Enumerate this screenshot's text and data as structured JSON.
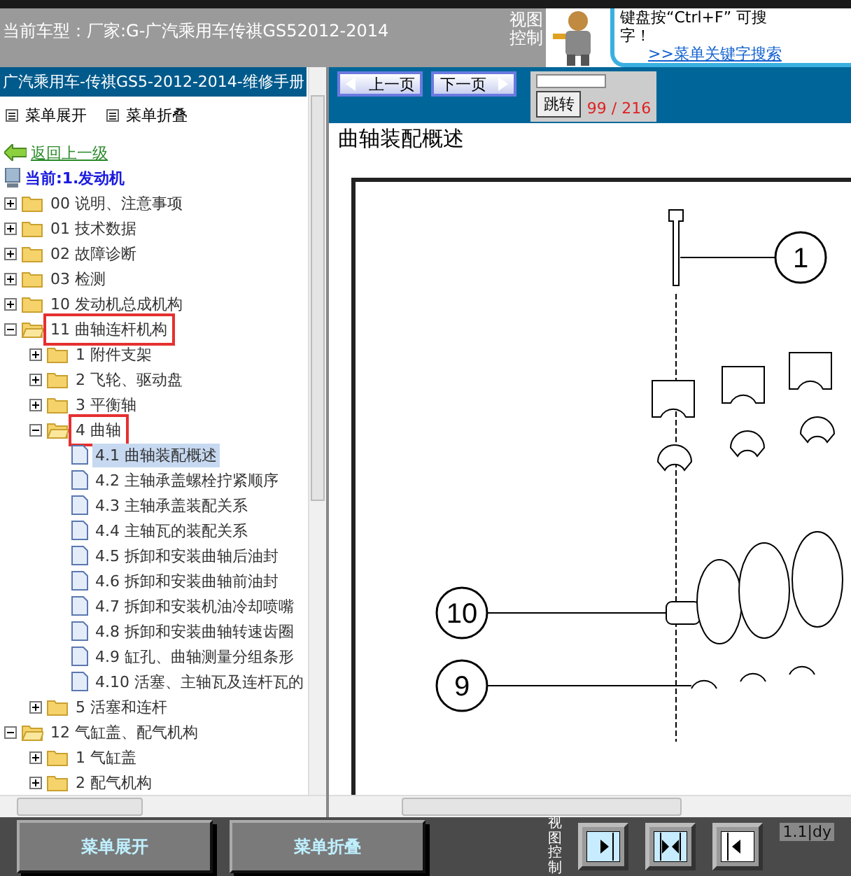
{
  "header": {
    "vehicle": "当前车型：厂家:G-广汽乘用车传祺GS52012-2014",
    "view_control": "视图控制",
    "tip_lines": [
      "键盘按“Ctrl+F” 可搜",
      "字！"
    ],
    "tip_link": ">>菜单关键字搜索"
  },
  "sidebar": {
    "title": "广汽乘用车-传祺GS5-2012-2014-维修手册",
    "menu": [
      "菜单展开",
      "菜单折叠"
    ],
    "back_link": "返回上一级",
    "current": "当前:1.发动机",
    "nodes": [
      {
        "label": "00 说明、注意事项",
        "kind": "folder",
        "expanded": false,
        "selected": false,
        "marked": false
      },
      {
        "label": "01 技术数据",
        "kind": "folder",
        "expanded": false,
        "selected": false,
        "marked": false
      },
      {
        "label": "02 故障诊断",
        "kind": "folder",
        "expanded": false,
        "selected": false,
        "marked": false
      },
      {
        "label": "03 检测",
        "kind": "folder",
        "expanded": false,
        "selected": false,
        "marked": false
      },
      {
        "label": "10 发动机总成机构",
        "kind": "folder",
        "expanded": false,
        "selected": false,
        "marked": false
      },
      {
        "label": "11 曲轴连杆机构",
        "kind": "folder",
        "expanded": true,
        "selected": false,
        "marked": true,
        "children": [
          {
            "label": "1 附件支架",
            "kind": "folder",
            "expanded": false,
            "selected": false,
            "marked": false
          },
          {
            "label": "2 飞轮、驱动盘",
            "kind": "folder",
            "expanded": false,
            "selected": false,
            "marked": false
          },
          {
            "label": "3 平衡轴",
            "kind": "folder",
            "expanded": false,
            "selected": false,
            "marked": false
          },
          {
            "label": "4 曲轴",
            "kind": "folder",
            "expanded": true,
            "selected": false,
            "marked": true,
            "children": [
              {
                "label": "4.1 曲轴装配概述",
                "kind": "page",
                "selected": true,
                "marked": false
              },
              {
                "label": "4.2 主轴承盖螺栓拧紧顺序",
                "kind": "page",
                "selected": false,
                "marked": false
              },
              {
                "label": "4.3 主轴承盖装配关系",
                "kind": "page",
                "selected": false,
                "marked": false
              },
              {
                "label": "4.4 主轴瓦的装配关系",
                "kind": "page",
                "selected": false,
                "marked": false
              },
              {
                "label": "4.5 拆卸和安装曲轴后油封",
                "kind": "page",
                "selected": false,
                "marked": false
              },
              {
                "label": "4.6 拆卸和安装曲轴前油封",
                "kind": "page",
                "selected": false,
                "marked": false
              },
              {
                "label": "4.7 拆卸和安装机油冷却喷嘴",
                "kind": "page",
                "selected": false,
                "marked": false
              },
              {
                "label": "4.8 拆卸和安装曲轴转速齿圈",
                "kind": "page",
                "selected": false,
                "marked": false
              },
              {
                "label": "4.9 缸孔、曲轴测量分组条形",
                "kind": "page",
                "selected": false,
                "marked": false
              },
              {
                "label": "4.10 活塞、主轴瓦及连杆瓦的",
                "kind": "page",
                "selected": false,
                "marked": false
              }
            ]
          },
          {
            "label": "5 活塞和连杆",
            "kind": "folder",
            "expanded": false,
            "selected": false,
            "marked": false
          }
        ]
      },
      {
        "label": "12 气缸盖、配气机构",
        "kind": "folder",
        "expanded": true,
        "selected": false,
        "marked": false,
        "children": [
          {
            "label": "1 气缸盖",
            "kind": "folder",
            "expanded": false,
            "selected": false,
            "marked": false
          },
          {
            "label": "2 配气机构",
            "kind": "folder",
            "expanded": false,
            "selected": false,
            "marked": false
          }
        ]
      }
    ]
  },
  "viewer": {
    "prev": "上一页",
    "next": "下一页",
    "jump": "跳转",
    "page": "99 / 216",
    "heading": "曲轴装配概述",
    "callouts": [
      "1",
      "10",
      "9"
    ]
  },
  "footer": {
    "buttons": [
      "菜单展开",
      "菜单折叠"
    ],
    "view_control": "视图控制",
    "version": "1.1|dy"
  }
}
